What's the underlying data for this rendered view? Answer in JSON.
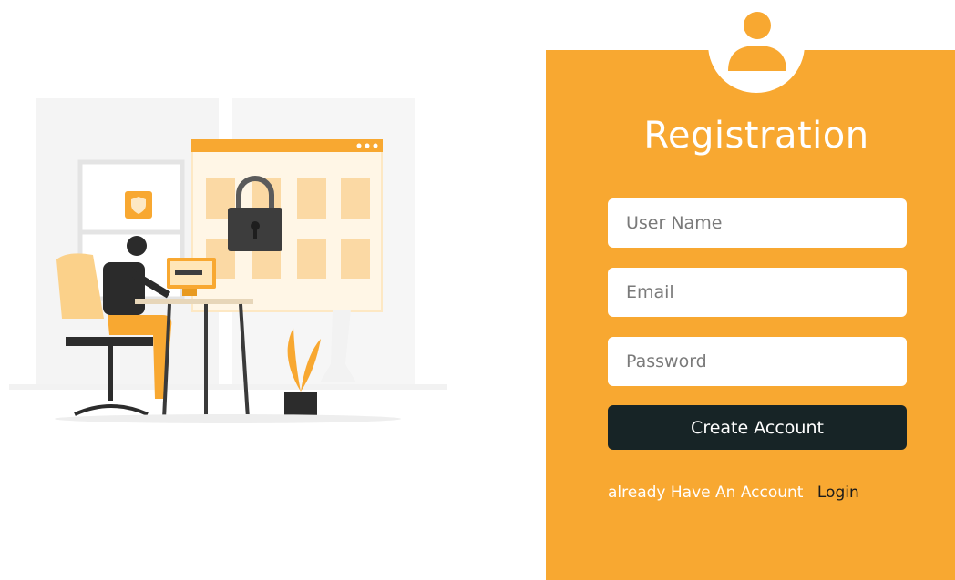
{
  "form": {
    "title": "Registration",
    "username_placeholder": "User Name",
    "email_placeholder": "Email",
    "password_placeholder": "Password",
    "submit_label": "Create Account",
    "login_prompt": "already Have An Account",
    "login_link": "Login"
  },
  "icons": {
    "avatar": "user-icon",
    "illustration": "security-login-illustration"
  },
  "colors": {
    "accent": "#f8a831",
    "button": "#172426",
    "text_light": "#ffffff"
  }
}
